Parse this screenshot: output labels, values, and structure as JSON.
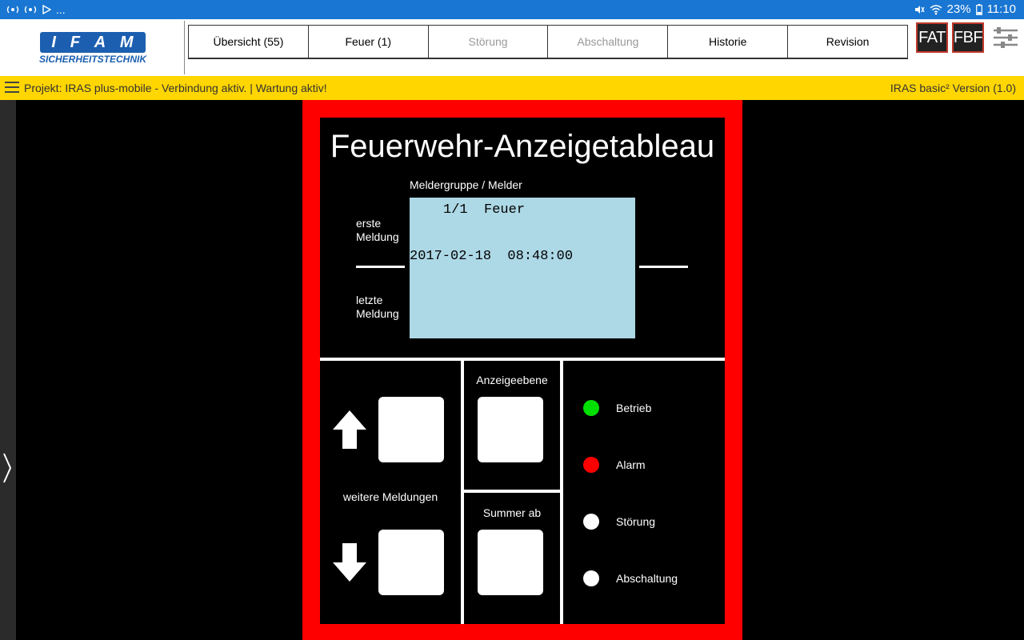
{
  "statusbar": {
    "left_icons": [
      "signal-icon",
      "signal-icon",
      "play-icon"
    ],
    "overflow": "...",
    "battery": "23%",
    "time": "11:10"
  },
  "logo": {
    "letters": [
      "I",
      "F",
      "A",
      "M"
    ],
    "subtitle": "SICHERHEITSTECHNIK"
  },
  "tabs": [
    {
      "label": "Übersicht (55)",
      "enabled": true
    },
    {
      "label": "Feuer (1)",
      "enabled": true
    },
    {
      "label": "Störung",
      "enabled": false
    },
    {
      "label": "Abschaltung",
      "enabled": false
    },
    {
      "label": "Historie",
      "enabled": true
    },
    {
      "label": "Revision",
      "enabled": true
    }
  ],
  "header_buttons": {
    "fat": "FAT",
    "fbf": "FBF"
  },
  "infobar": {
    "project": "Projekt:  IRAS plus-mobile  -  Verbindung aktiv. | Wartung aktiv!",
    "version": "IRAS basic² Version (1.0)"
  },
  "panel": {
    "title": "Feuerwehr-Anzeigetableau",
    "meldergruppe_label": "Meldergruppe / Melder",
    "display_line1": "1/1  Feuer",
    "display_line2": "2017-02-18  08:48:00",
    "erste_meldung": "erste Meldung",
    "letzte_meldung": "letzte Meldung",
    "weitere_meldungen": "weitere Meldungen",
    "anzeigeebene": "Anzeigeebene",
    "summer_ab": "Summer ab",
    "leds": [
      {
        "label": "Betrieb",
        "color": "#00e000"
      },
      {
        "label": "Alarm",
        "color": "#ff0000"
      },
      {
        "label": "Störung",
        "color": "#ffffff"
      },
      {
        "label": "Abschaltung",
        "color": "#ffffff"
      }
    ]
  },
  "colors": {
    "statusbar": "#1976d2",
    "infobar": "#ffd600",
    "panel_border": "#ff0000",
    "display": "#add8e6"
  }
}
